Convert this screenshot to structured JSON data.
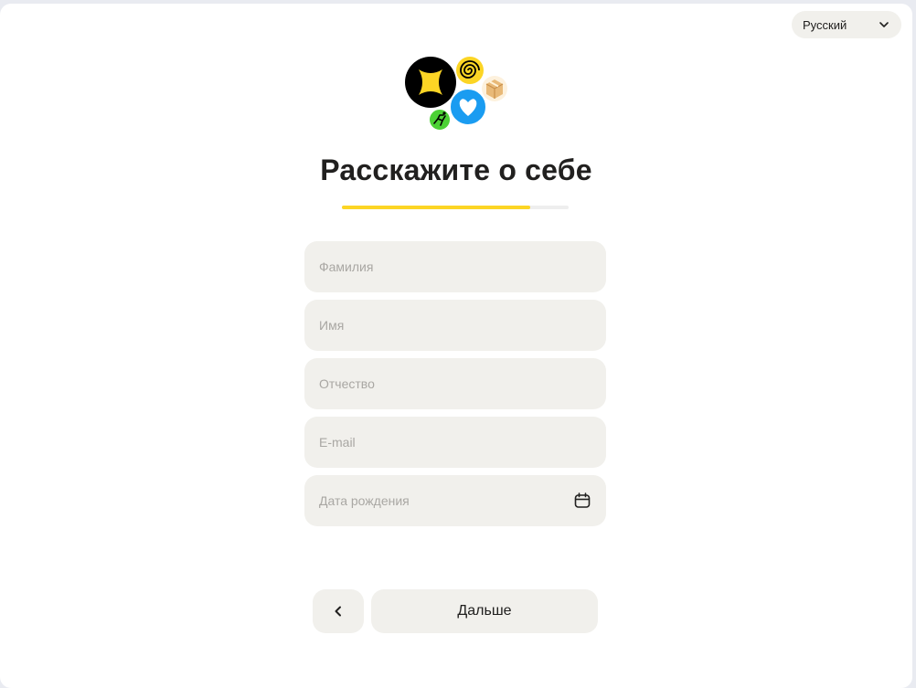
{
  "language_select": {
    "selected": "Русский",
    "icon": "chevron-down-icon"
  },
  "logo": {
    "icons": [
      "yandex-pro-icon",
      "spiral-icon",
      "box-icon",
      "heart-icon",
      "runner-icon"
    ],
    "colors": {
      "yellow": "#fcd525",
      "black": "#000000",
      "blue": "#1a9cf1",
      "green": "#4cd135",
      "cardboard": "#e8b978"
    }
  },
  "page": {
    "title": "Расскажите о себе"
  },
  "progress": {
    "value": 0.83,
    "color": "#fcd525"
  },
  "form": {
    "last_name": {
      "placeholder": "Фамилия",
      "value": ""
    },
    "first_name": {
      "placeholder": "Имя",
      "value": ""
    },
    "middle_name": {
      "placeholder": "Отчество",
      "value": ""
    },
    "email": {
      "placeholder": "E-mail",
      "value": ""
    },
    "birth_date": {
      "placeholder": "Дата рождения",
      "value": "",
      "icon": "calendar-icon"
    }
  },
  "actions": {
    "back_icon": "chevron-left-icon",
    "next_label": "Дальше"
  }
}
